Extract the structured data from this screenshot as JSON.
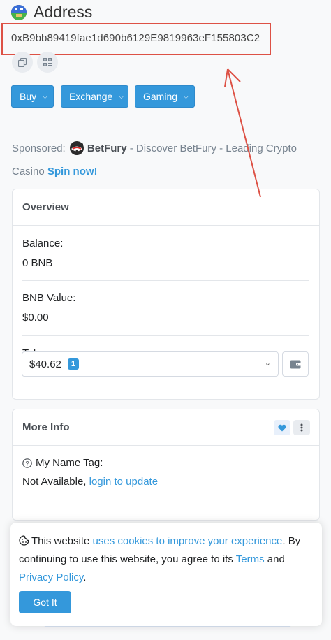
{
  "header": {
    "title": "Address"
  },
  "address": {
    "value": "0xB9bb89419fae1d690b6129E9819963eF155803C2"
  },
  "buttons": {
    "buy": "Buy",
    "exchange": "Exchange",
    "gaming": "Gaming"
  },
  "sponsor": {
    "prefix": "Sponsored:",
    "brand": "BetFury",
    "text": "- Discover BetFury - Leading Crypto Casino",
    "cta": "Spin now!"
  },
  "overview": {
    "title": "Overview",
    "balance_label": "Balance:",
    "balance_value": "0 BNB",
    "bnb_value_label": "BNB Value:",
    "bnb_value": "$0.00",
    "token_label": "Token:",
    "token_value": "$40.62",
    "token_count": "1"
  },
  "more_info": {
    "title": "More Info",
    "name_tag_label": "My Name Tag:",
    "name_tag_value": "Not Available,",
    "name_tag_link": "login to update"
  },
  "cookie": {
    "text1": "This website",
    "link1": "uses cookies to improve your experience",
    "text2": ". By continuing to use this website, you agree to its",
    "link2": "Terms",
    "text3": "and",
    "link3": "Privacy Policy",
    "text4": ".",
    "button": "Got It"
  },
  "colors": {
    "accent": "#3498db",
    "annotation": "#dd5145"
  },
  "icons": [
    "avatar-icon",
    "copy-icon",
    "qr-code-icon",
    "chevron-down-icon",
    "wallet-icon",
    "heart-icon",
    "more-vertical-icon",
    "question-circle-icon",
    "cookie-icon",
    "betfury-logo-icon"
  ]
}
